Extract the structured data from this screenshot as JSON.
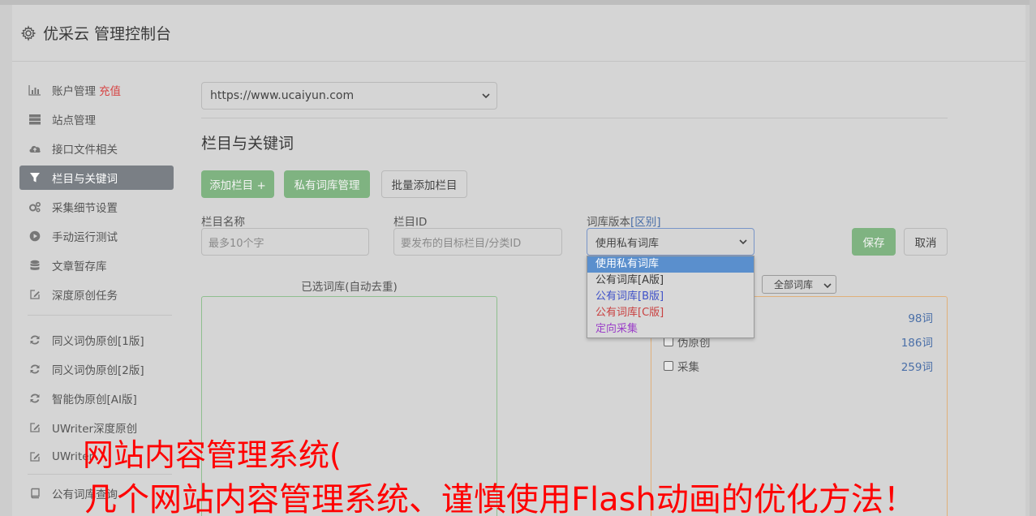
{
  "header": {
    "title": "优采云 管理控制台",
    "icon": "gear-icon"
  },
  "sidebar": {
    "items": [
      {
        "label": "账户管理",
        "extra": "充值",
        "icon": "bar-chart-icon"
      },
      {
        "label": "站点管理",
        "icon": "server-icon"
      },
      {
        "label": "接口文件相关",
        "icon": "cloud-upload-icon"
      },
      {
        "label": "栏目与关键词",
        "icon": "filter-icon",
        "active": true
      },
      {
        "label": "采集细节设置",
        "icon": "cogs-icon"
      },
      {
        "label": "手动运行测试",
        "icon": "play-circle-icon"
      },
      {
        "label": "文章暂存库",
        "icon": "database-icon"
      },
      {
        "label": "深度原创任务",
        "icon": "edit-icon"
      }
    ],
    "items2": [
      {
        "label": "同义词伪原创[1版]",
        "icon": "refresh-icon"
      },
      {
        "label": "同义词伪原创[2版]",
        "icon": "refresh-icon"
      },
      {
        "label": "智能伪原创[AI版]",
        "icon": "refresh-icon"
      },
      {
        "label": "UWriter深度原创",
        "icon": "edit-icon"
      },
      {
        "label": "UWriter",
        "icon": "edit-icon"
      }
    ],
    "items3": [
      {
        "label": "公有词库查询",
        "icon": "book-icon"
      }
    ]
  },
  "site_select": {
    "value": "https://www.ucaiyun.com"
  },
  "section": {
    "title": "栏目与关键词"
  },
  "buttons": {
    "add_column": "添加栏目 +",
    "private_lib": "私有词库管理",
    "batch_add": "批量添加栏目",
    "save": "保存",
    "cancel": "取消"
  },
  "form": {
    "column_name_label": "栏目名称",
    "column_name_placeholder": "最多10个字",
    "column_id_label": "栏目ID",
    "column_id_placeholder": "要发布的目标栏目/分类ID",
    "version_label": "词库版本",
    "version_link": "[区别]",
    "version_value": "使用私有词库"
  },
  "dropdown": {
    "options": [
      {
        "label": "使用私有词库",
        "color": "#ffffff"
      },
      {
        "label": "公有词库[A版]",
        "color": "#3a3a3a"
      },
      {
        "label": "公有词库[B版]",
        "color": "#3f51c8"
      },
      {
        "label": "公有词库[C版]",
        "color": "#c94040"
      },
      {
        "label": "定向采集",
        "color": "#9b3fc8"
      }
    ]
  },
  "selected_box": {
    "title": "已选词库(自动去重)"
  },
  "library": {
    "filter": "全部词库",
    "rows": [
      {
        "name": "",
        "count": "98词"
      },
      {
        "name": "伪原创",
        "count": "186词"
      },
      {
        "name": "采集",
        "count": "259词"
      }
    ]
  },
  "overlay": {
    "line1": "网站内容管理系统(",
    "line2": "几个网站内容管理系统、谨慎使用Flash动画的优化方法！"
  },
  "colors": {
    "active_nav": "#7a7f85",
    "green_button": "#7fb381",
    "overlay_text": "#ff0000",
    "accent_link": "#4a6fa8"
  }
}
